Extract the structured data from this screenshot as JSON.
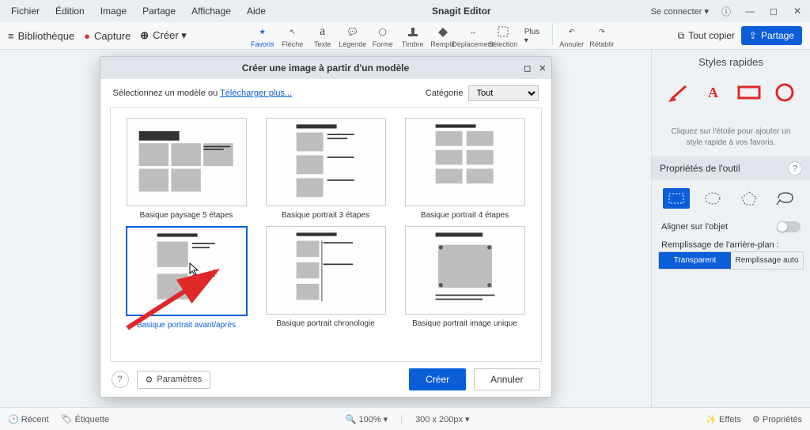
{
  "app": {
    "title": "Snagit Editor"
  },
  "menu": [
    "Fichier",
    "Édition",
    "Image",
    "Partage",
    "Affichage",
    "Aide"
  ],
  "connect": "Se connecter ▾",
  "toolbar_left": {
    "library": "Bibliothèque",
    "capture": "Capture",
    "create": "Créer ▾"
  },
  "tools": [
    "Favoris",
    "Flèche",
    "Texte",
    "Légende",
    "Forme",
    "Timbre",
    "Remplir",
    "Déplacement",
    "Sélection"
  ],
  "tool_more": "Plus ▾",
  "tool_undo": "Annuler",
  "tool_redo": "Rétablir",
  "copy_all": "Tout copier",
  "share": "Partage",
  "quick_styles_title": "Styles rapides",
  "quick_hint": "Cliquez sur l'étoile pour ajouter un style rapide à vos favoris.",
  "props_title": "Propriétés de l'outil",
  "align_label": "Aligner sur l'objet",
  "fill_label": "Remplissage de l'arrière-plan :",
  "fill_opts": [
    "Transparent",
    "Remplissage auto"
  ],
  "status": {
    "recent": "Récent",
    "tag": "Étiquette",
    "zoom": "100% ▾",
    "size": "300 x 200px ▾",
    "effects": "Effets",
    "props": "Propriétés"
  },
  "modal": {
    "title": "Créer une image à partir d'un modèle",
    "subtitle_pre": "Sélectionnez un modèle ou ",
    "subtitle_link": "Télécharger plus...",
    "cat_label": "Catégorie",
    "cat_value": "Tout",
    "templates": [
      "Basique paysage 5 étapes",
      "Basique portrait 3 étapes",
      "Basique portrait 4 étapes",
      "Basique portrait avant/après",
      "Basique portrait chronologie",
      "Basique portrait image unique"
    ],
    "settings": "Paramètres",
    "create": "Créer",
    "cancel": "Annuler"
  }
}
